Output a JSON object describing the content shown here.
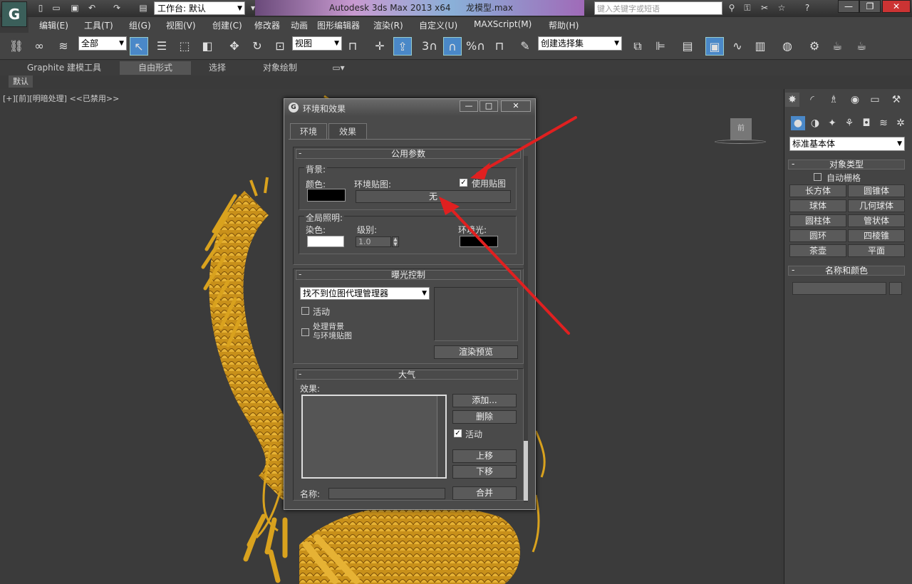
{
  "titlebar": {
    "workspace_label": "工作台: 默认",
    "app_title": "Autodesk 3ds Max  2013 x64",
    "file_name": "龙模型.max",
    "search_placeholder": "键入关键字或短语",
    "minimize": "—",
    "restore": "❐",
    "close": "✕"
  },
  "menus": [
    "编辑(E)",
    "工具(T)",
    "组(G)",
    "视图(V)",
    "创建(C)",
    "修改器",
    "动画",
    "图形编辑器",
    "渲染(R)",
    "自定义(U)",
    "MAXScript(M)",
    "帮助(H)"
  ],
  "toolbar": {
    "selection_filter": "全部",
    "reference_coord": "视图",
    "named_selection": "创建选择集",
    "snap_3": "3",
    "snap_percent": "%"
  },
  "ribbon": {
    "tabs": [
      "Graphite 建模工具",
      "自由形式",
      "选择",
      "对象绘制"
    ],
    "sub_label": "默认"
  },
  "viewport": {
    "label": "[+][前][明暗处理] <<已禁用>>",
    "viewcube": "前"
  },
  "right_panel": {
    "category": "标准基本体",
    "object_type_header": "对象类型",
    "autogrid": "自动栅格",
    "buttons": [
      "长方体",
      "圆锥体",
      "球体",
      "几何球体",
      "圆柱体",
      "管状体",
      "圆环",
      "四棱锥",
      "茶壶",
      "平面"
    ],
    "name_color_header": "名称和颜色"
  },
  "dialog": {
    "title": "环境和效果",
    "minimize": "—",
    "maximize": "□",
    "close": "✕",
    "tabs": [
      "环境",
      "效果"
    ],
    "common_params": "公用参数",
    "background_label": "背景:",
    "color_label": "颜色:",
    "env_map_label": "环境贴图:",
    "use_map_label": "使用贴图",
    "use_map_checked": "✓",
    "map_button": "无",
    "global_lighting_label": "全局照明:",
    "tint_label": "染色:",
    "level_label": "级别:",
    "level_value": "1.0",
    "ambient_label": "环境光:",
    "exposure_header": "曝光控制",
    "exposure_select": "找不到位图代理管理器",
    "active_label": "活动",
    "process_bg_line1": "处理背景",
    "process_bg_line2": "与环境贴图",
    "render_preview": "渲染预览",
    "atmosphere_header": "大气",
    "effects_label": "效果:",
    "add_button": "添加...",
    "delete_button": "删除",
    "atm_active_label": "活动",
    "atm_active_checked": "✓",
    "move_up": "上移",
    "move_down": "下移",
    "name_label": "名称:",
    "merge_button": "合并"
  },
  "colors": {
    "background_swatch": "#000000",
    "tint_swatch": "#ffffff",
    "ambient_swatch": "#000000",
    "annotation_arrow": "#e02020",
    "dragon_gold": "#d9a21e"
  }
}
